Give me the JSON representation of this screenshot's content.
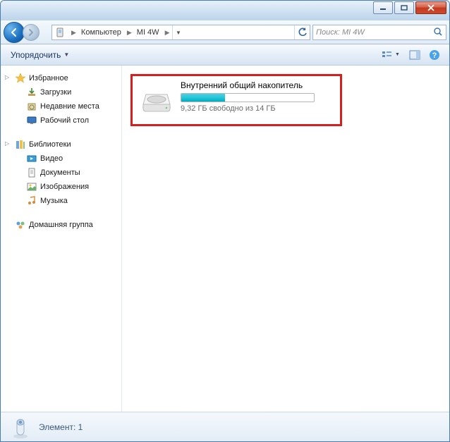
{
  "breadcrumb": {
    "seg1": "Компьютер",
    "seg2": "MI 4W"
  },
  "search": {
    "placeholder": "Поиск: MI 4W"
  },
  "toolbar": {
    "organize": "Упорядочить"
  },
  "sidebar": {
    "favorites": {
      "label": "Избранное",
      "items": [
        "Загрузки",
        "Недавние места",
        "Рабочий стол"
      ]
    },
    "libraries": {
      "label": "Библиотеки",
      "items": [
        "Видео",
        "Документы",
        "Изображения",
        "Музыка"
      ]
    },
    "homegroup": {
      "label": "Домашняя группа"
    }
  },
  "drive": {
    "title": "Внутренний общий накопитель",
    "subtitle": "9,32 ГБ свободно из 14 ГБ",
    "used_percent": 33
  },
  "status": {
    "text": "Элемент: 1"
  }
}
